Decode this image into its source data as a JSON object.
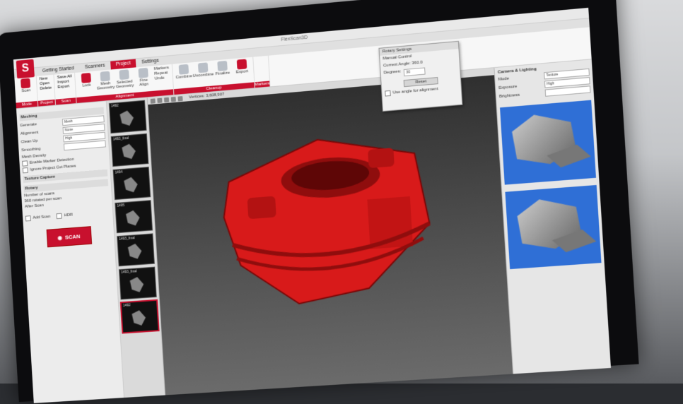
{
  "window": {
    "title": "FlexScan3D"
  },
  "tabs": [
    {
      "label": "Getting Started"
    },
    {
      "label": "Scanners"
    },
    {
      "label": "Project"
    },
    {
      "label": "Settings"
    }
  ],
  "ribbon": {
    "mode": {
      "label": "Mode",
      "buttons": [
        "Scan"
      ]
    },
    "project": {
      "label": "Project",
      "items": [
        "New",
        "Open",
        "Delete"
      ]
    },
    "scan": {
      "label": "Scan",
      "items": [
        "Save All",
        "Import",
        "Export"
      ]
    },
    "alignment": {
      "label": "Alignment",
      "buttons": [
        "Lock",
        "Mesh Geometry",
        "Selected Geometry",
        "Fine Align",
        "Markers"
      ],
      "items": [
        "Repeat",
        "Undo"
      ]
    },
    "cleanup": {
      "label": "Cleanup",
      "buttons": [
        "Combine",
        "Uncombine",
        "Finalize",
        "Export"
      ]
    },
    "markers": {
      "label": "Markers"
    }
  },
  "left_panel": {
    "section_meshing": "Meshing",
    "fields": [
      {
        "label": "Generate",
        "value": "Mesh"
      },
      {
        "label": "Alignment",
        "value": "None"
      },
      {
        "label": "Clean Up",
        "value": "High"
      },
      {
        "label": "Smoothing",
        "value": ""
      }
    ],
    "checks": [
      "Mesh Density",
      "Enable Marker Detection",
      "Ignore Project Cut Planes"
    ],
    "section_texture": "Texture Capture",
    "section_rotary": "Rotary",
    "rotary_fields": [
      "Number of scans",
      "360 rotated per scan",
      "After Scan"
    ],
    "bottom_checks": [
      "Add Scan",
      "HDR"
    ],
    "scan_button": "SCAN"
  },
  "thumbnails": [
    {
      "label": "1492"
    },
    {
      "label": "1493_final"
    },
    {
      "label": "1494"
    },
    {
      "label": "1495"
    },
    {
      "label": "1493_final"
    },
    {
      "label": "1493_final"
    },
    {
      "label": "1492"
    }
  ],
  "viewport": {
    "vertices": "Vertices: 3,608,907"
  },
  "dialog": {
    "title": "Rotary Settings",
    "sub": "Manual Control",
    "camera_label": "Current Angle: 360.0",
    "degrees_label": "Degrees:",
    "degrees_value": "30",
    "buttons": [
      "Reset"
    ],
    "check": "Use angle for alignment"
  },
  "right_panel": {
    "header": "Camera & Lighting",
    "rows": [
      {
        "label": "Mode",
        "value": "Texture"
      },
      {
        "label": "Exposure",
        "value": "High"
      },
      {
        "label": "Brightness",
        "value": ""
      }
    ]
  },
  "colors": {
    "accent": "#c8102e",
    "preview_bg": "#2f6fd6",
    "model": "#d81a1a"
  }
}
